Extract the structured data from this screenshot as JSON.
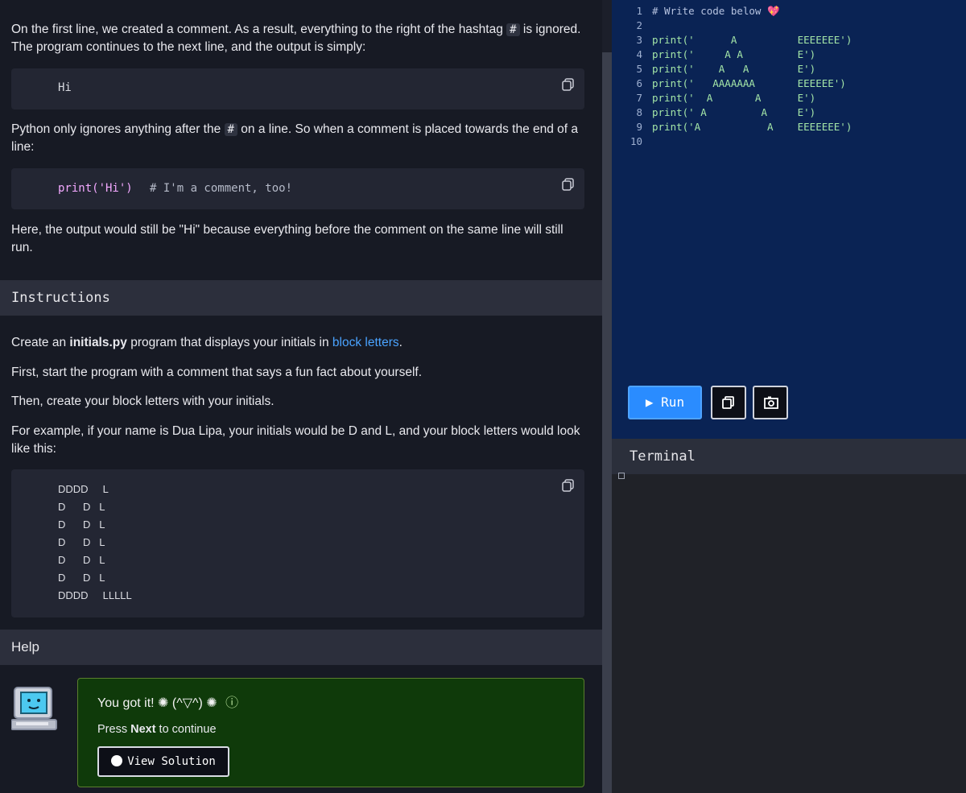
{
  "lesson": {
    "p1_a": "On the first line, we created a comment. As a result, everything to the right of the hashtag ",
    "p1_hash": "#",
    "p1_b": " is ignored. The program continues to the next line, and the output is simply:",
    "output_hi": "Hi",
    "p2_a": "Python only ignores anything after the ",
    "p2_hash": "#",
    "p2_b": " on a line. So when a comment is placed towards the end of a line:",
    "code_print": "print('Hi')",
    "code_comment": "# I'm a comment, too!",
    "p3": "Here, the output would still be \"Hi\" because everything before the comment on the same line will still run."
  },
  "instructions": {
    "header": "Instructions",
    "line1_a": "Create an ",
    "line1_file": "initials.py",
    "line1_b": " program that displays your initials in ",
    "line1_link": "block letters",
    "line1_c": ".",
    "line2": "First, start the program with a comment that says a fun fact about yourself.",
    "line3": "Then, create your block letters with your initials.",
    "line4": "For example, if your name is Dua Lipa, your initials would be D and L, and your block letters would look like this:",
    "block_lines": [
      "DDDD     L",
      "D      D   L",
      "D      D   L",
      "D      D   L",
      "D      D   L",
      "D      D   L",
      "DDDD     LLLLL"
    ]
  },
  "help": {
    "header": "Help",
    "title": "You got it! ✺ (^▽^) ✺",
    "info_icon": "ⓘ",
    "press_a": "Press ",
    "press_next": "Next",
    "press_b": " to continue",
    "view_solution": "View Solution"
  },
  "editor": {
    "lines": [
      {
        "n": "1",
        "code": "# Write code below 💖"
      },
      {
        "n": "2",
        "code": ""
      },
      {
        "n": "3",
        "code": "print('      A          EEEEEEE')"
      },
      {
        "n": "4",
        "code": "print('     A A         E')"
      },
      {
        "n": "5",
        "code": "print('    A   A        E')"
      },
      {
        "n": "6",
        "code": "print('   AAAAAAA       EEEEEE')"
      },
      {
        "n": "7",
        "code": "print('  A       A      E')"
      },
      {
        "n": "8",
        "code": "print(' A         A     E')"
      },
      {
        "n": "9",
        "code": "print('A           A    EEEEEEE')"
      },
      {
        "n": "10",
        "code": ""
      }
    ],
    "run_label": "▶ Run",
    "terminal_label": "Terminal"
  },
  "colors": {
    "editor_bg": "#0a2354",
    "run_blue": "#2a8cff",
    "help_green": "#0f3a0a",
    "link_blue": "#4aa3ff"
  }
}
